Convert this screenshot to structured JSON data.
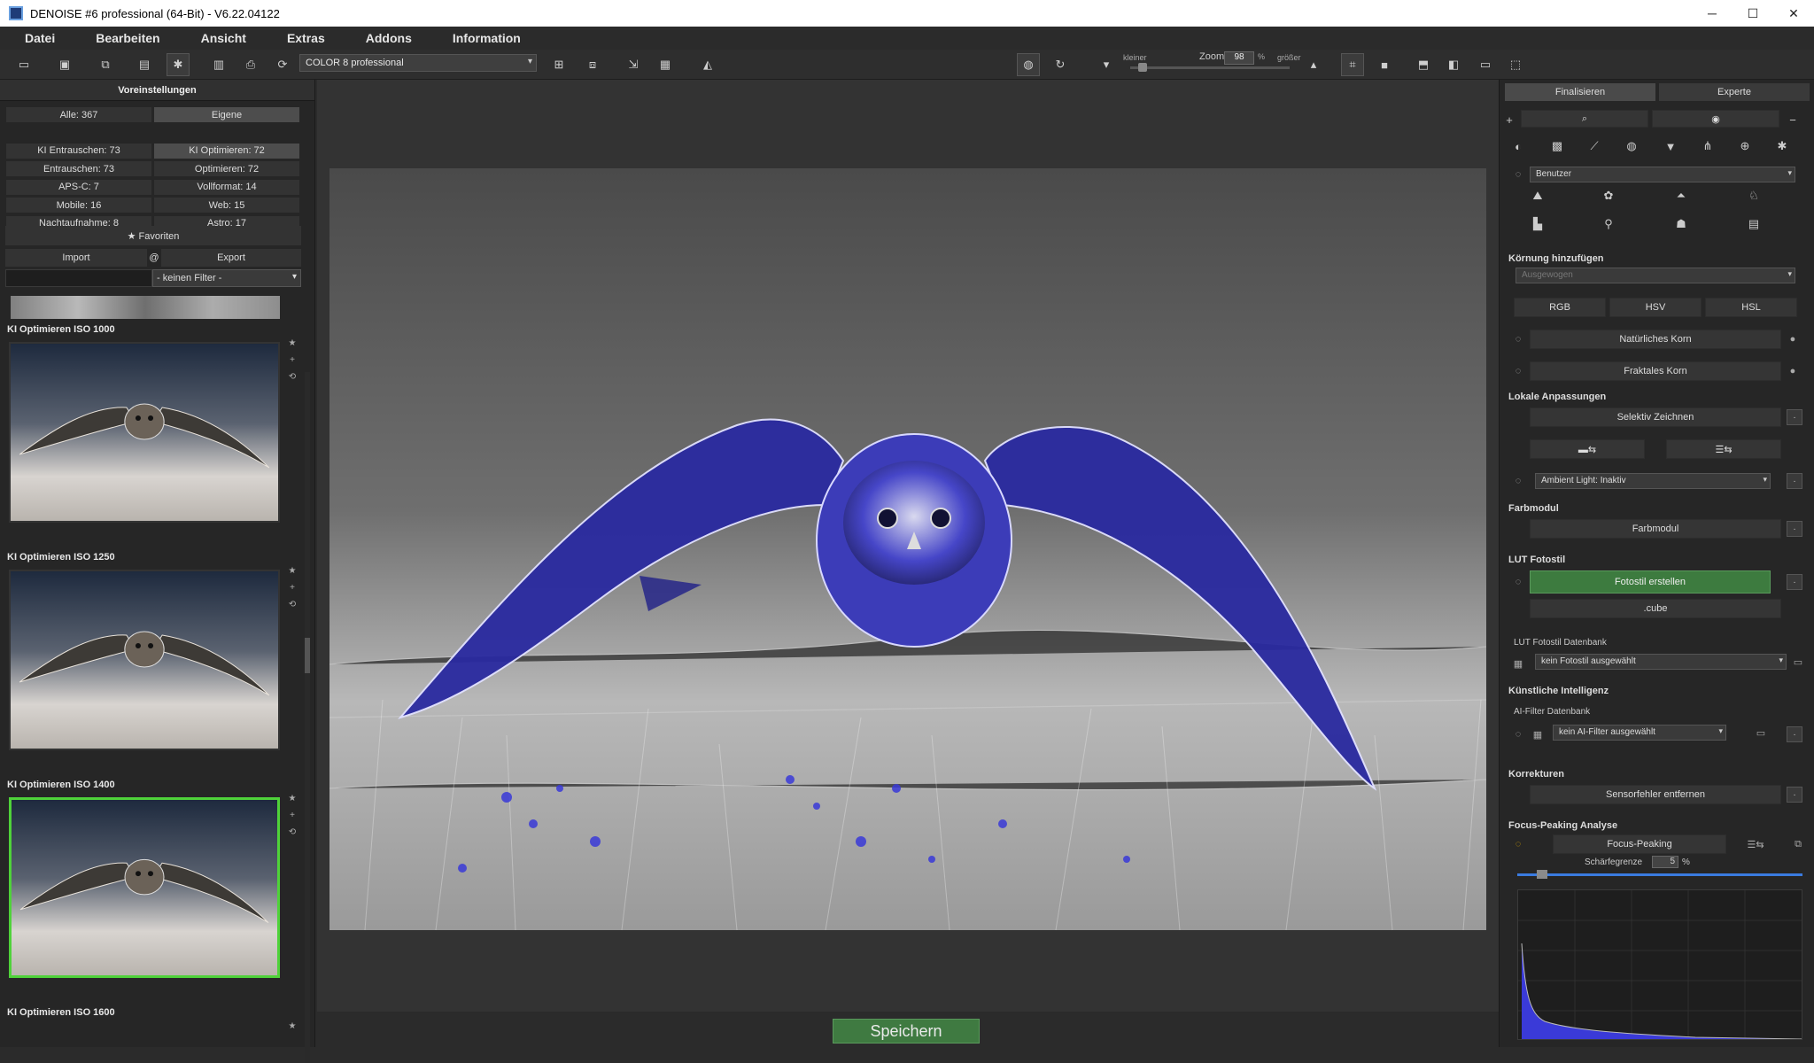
{
  "window": {
    "title": "DENOISE #6 professional (64-Bit) - V6.22.04122",
    "min": "─",
    "max": "☐",
    "close": "✕"
  },
  "menu": [
    "Datei",
    "Bearbeiten",
    "Ansicht",
    "Extras",
    "Addons",
    "Information"
  ],
  "toolbar": {
    "preset_select": "COLOR 8 professional",
    "zoom_label": "Zoom",
    "zoom_value": "98",
    "zoom_unit": "%",
    "smaller": "kleiner",
    "larger": "größer",
    "zoom_level": 0.05
  },
  "left": {
    "header": "Voreinstellungen",
    "categories": [
      {
        "label": "Alle: 367",
        "selected": false
      },
      {
        "label": "Eigene",
        "selected": true
      },
      {
        "label": "KI Entrauschen: 73",
        "selected": false
      },
      {
        "label": "KI Optimieren: 72",
        "selected": true
      },
      {
        "label": "Entrauschen: 73",
        "selected": false
      },
      {
        "label": "Optimieren: 72",
        "selected": false
      },
      {
        "label": "APS-C: 7",
        "selected": false
      },
      {
        "label": "Vollformat: 14",
        "selected": false
      },
      {
        "label": "Mobile: 16",
        "selected": false
      },
      {
        "label": "Web: 15",
        "selected": false
      },
      {
        "label": "Nachtaufnahme: 8",
        "selected": false
      },
      {
        "label": "Astro: 17",
        "selected": false
      }
    ],
    "favorites": "★ Favoriten",
    "import": "Import",
    "at": "@",
    "export": "Export",
    "filter": "- keinen Filter -",
    "presets": [
      {
        "label": "KI Optimieren ISO 1000",
        "selected": false
      },
      {
        "label": "KI Optimieren ISO 1250",
        "selected": false
      },
      {
        "label": "KI Optimieren ISO 1400",
        "selected": true
      },
      {
        "label": "KI Optimieren ISO 1600",
        "selected": false
      }
    ]
  },
  "center": {
    "save": "Speichern"
  },
  "right": {
    "tabs": [
      "Finalisieren",
      "Experte"
    ],
    "user_select": "Benutzer",
    "grain_title": "Körnung hinzufügen",
    "grain_select": "Ausgewogen",
    "color_modes": [
      "RGB",
      "HSV",
      "HSL"
    ],
    "natural_grain": "Natürliches Korn",
    "fractal_grain": "Fraktales Korn",
    "local_title": "Lokale Anpassungen",
    "selective": "Selektiv Zeichnen",
    "ambient": "Ambient Light: Inaktiv",
    "farb_title": "Farbmodul",
    "farb_btn": "Farbmodul",
    "lut_title": "LUT Fotostil",
    "lut_btn": "Fotostil erstellen",
    "cube": ".cube",
    "lut_db": "LUT Fotostil Datenbank",
    "lut_select": "kein Fotostil ausgewählt",
    "ki_title": "Künstliche Intelligenz",
    "ai_db": "AI-Filter Datenbank",
    "ai_select": "kein AI-Filter ausgewählt",
    "korr_title": "Korrekturen",
    "sensor": "Sensorfehler entfernen",
    "focus_title": "Focus-Peaking Analyse",
    "focus_btn": "Focus-Peaking",
    "sharp_label": "Schärfegrenze",
    "sharp_value": "5",
    "sharp_unit": "%",
    "sharp_level": 0.05,
    "colors": {
      "accent_green": "#3d7b3f",
      "selection_green": "#4fd23a",
      "highlight_blue": "#3a3ad8"
    }
  }
}
